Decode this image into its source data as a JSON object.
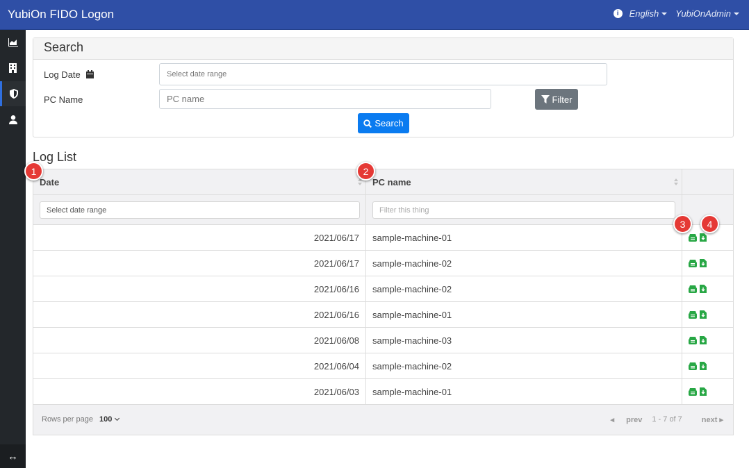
{
  "app": {
    "title": "YubiOn FIDO Logon"
  },
  "topbar": {
    "language": "English",
    "user": "YubiOnAdmin"
  },
  "sidebar": {
    "items": [
      {
        "icon": "chart-icon"
      },
      {
        "icon": "building-icon"
      },
      {
        "icon": "shield-icon",
        "active": true
      },
      {
        "icon": "user-icon"
      }
    ],
    "toggle_icon": "expand-arrows-icon",
    "toggle_glyph": "↔"
  },
  "search": {
    "title": "Search",
    "log_date_label": "Log Date",
    "log_date_placeholder": "Select date range",
    "pc_name_label": "PC Name",
    "pc_name_placeholder": "PC name",
    "filter_label": "Filter",
    "search_label": "Search"
  },
  "log_list": {
    "title": "Log List",
    "columns": [
      "Date",
      "PC name"
    ],
    "filters": {
      "date_placeholder": "Select date range",
      "pc_placeholder": "Filter this thing"
    },
    "rows": [
      {
        "date": "2021/06/17",
        "pc": "sample-machine-01"
      },
      {
        "date": "2021/06/17",
        "pc": "sample-machine-02"
      },
      {
        "date": "2021/06/16",
        "pc": "sample-machine-02"
      },
      {
        "date": "2021/06/16",
        "pc": "sample-machine-01"
      },
      {
        "date": "2021/06/08",
        "pc": "sample-machine-03"
      },
      {
        "date": "2021/06/04",
        "pc": "sample-machine-02"
      },
      {
        "date": "2021/06/03",
        "pc": "sample-machine-01"
      }
    ],
    "footer": {
      "rows_per_page_label": "Rows per page",
      "rows_per_page_value": "100",
      "prev": "prev",
      "count": "1 - 7 of 7",
      "next": "next"
    }
  },
  "markers": [
    "1",
    "2",
    "3",
    "4"
  ],
  "colors": {
    "header": "#2f4fa6",
    "sidebar": "#23272b",
    "primary": "#0a7bf0",
    "secondary": "#6c757d",
    "success": "#28a745",
    "marker": "#e53935"
  }
}
